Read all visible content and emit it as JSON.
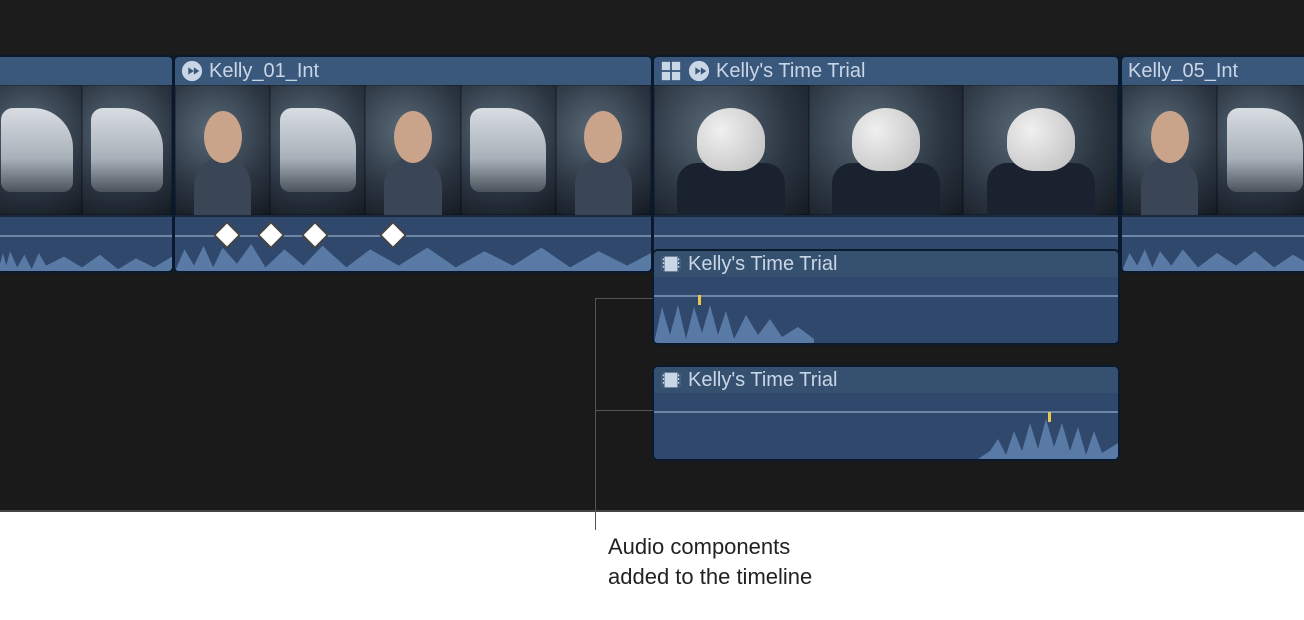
{
  "clips": {
    "left_partial": {
      "title": ""
    },
    "interview": {
      "title": "Kelly_01_Int"
    },
    "time_trial": {
      "title": "Kelly's Time Trial"
    },
    "right_partial": {
      "title": "Kelly_05_Int"
    }
  },
  "audio_components": {
    "a1": {
      "title": "Kelly's Time Trial"
    },
    "a2": {
      "title": "Kelly's Time Trial"
    }
  },
  "callout": {
    "line1": "Audio components",
    "line2": "added to the timeline"
  },
  "colors": {
    "clip_header": "#3a577c",
    "clip_body": "#2f486c",
    "timeline_bg": "#1a1a1a"
  }
}
